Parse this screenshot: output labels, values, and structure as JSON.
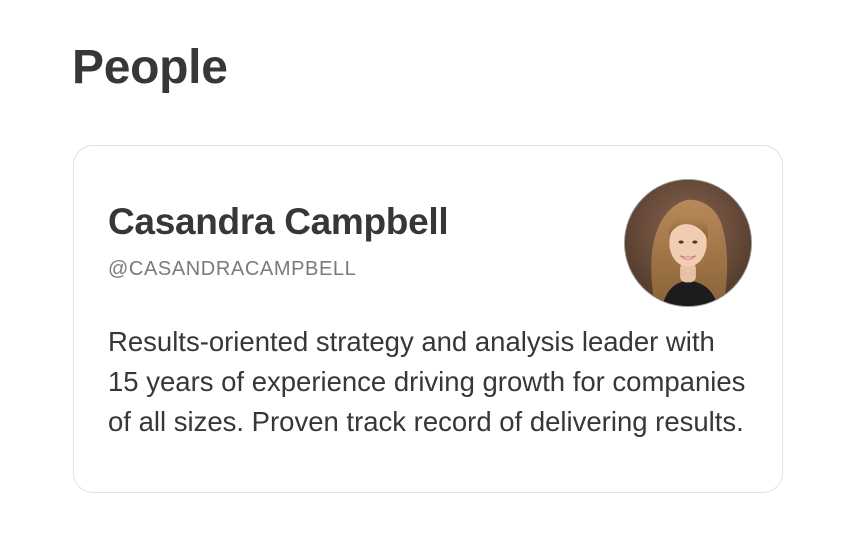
{
  "section": {
    "title": "People"
  },
  "person_card": {
    "name": "Casandra Campbell",
    "handle": "@CASANDRACAMPBELL",
    "bio": "Results-oriented strategy and analysis leader with 15 years of experience driving growth for companies of all sizes. Proven track record of delivering results.",
    "avatar_icon": "profile-photo"
  },
  "colors": {
    "text_primary": "#363737",
    "text_secondary": "#7a7a7a",
    "card_border": "#e3e3e3",
    "background": "#ffffff"
  }
}
